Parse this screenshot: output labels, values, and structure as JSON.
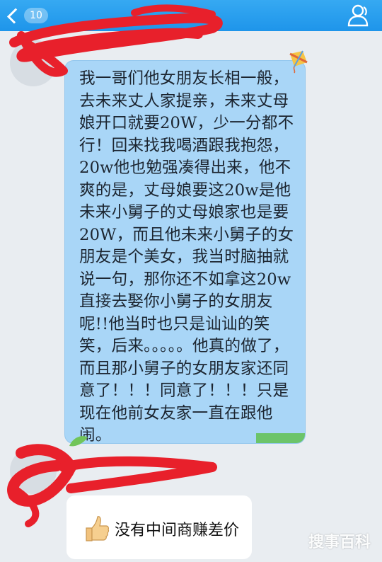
{
  "header": {
    "unread_count": "10",
    "back_icon": "chevron-left-icon",
    "profile_icon": "person-icon"
  },
  "message": {
    "text": "我一哥们他女朋友长相一般，去未来丈人家提亲，未来丈母娘开口就要20W，少一分都不行！回来找我喝酒跟我抱怨，20w他也勉强凑得出来，他不爽的是，丈母娘要这20w是他未来小舅子的丈母娘家也是要20W，而且他未来小舅子的女朋友是个美女，我当时脑抽就说一句，那你还不如拿这20w直接去娶你小舅子的女朋友呢!!他当时也只是讪讪的笑笑，后来。。。。。他真的做了，而且那小舅子的女朋友家还同意了！！！同意了！！！只是现在他前女友家一直在跟他闹。"
  },
  "reply": {
    "emoji": "thumbs-up-icon",
    "text": "没有中间商赚差价"
  },
  "watermark": "搜事百科",
  "colors": {
    "topbar": "#1e95ea",
    "bubble": "#a9d6f7",
    "scribble": "#e8202b"
  }
}
